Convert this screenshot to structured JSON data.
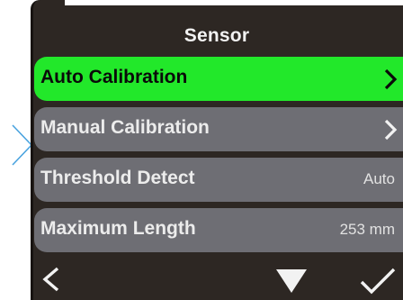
{
  "header": {
    "title": "Sensor"
  },
  "menu": {
    "items": [
      {
        "label": "Auto Calibration",
        "value": "",
        "has_arrow": true,
        "selected": true
      },
      {
        "label": "Manual Calibration",
        "value": "",
        "has_arrow": true,
        "selected": false
      },
      {
        "label": "Threshold Detect",
        "value": "Auto",
        "has_arrow": false,
        "selected": false
      },
      {
        "label": "Maximum Length",
        "value": "253 mm",
        "has_arrow": false,
        "selected": false
      }
    ]
  },
  "footer": {
    "buttons": [
      {
        "icon": "chevron-left-icon"
      },
      {
        "icon": "triangle-down-icon"
      },
      {
        "icon": "checkmark-icon"
      }
    ]
  },
  "colors": {
    "device_background": "#2d2723",
    "item_background": "#6e6e74",
    "selected_background": "#22e82a",
    "side_arrow": "#4aa3df"
  }
}
